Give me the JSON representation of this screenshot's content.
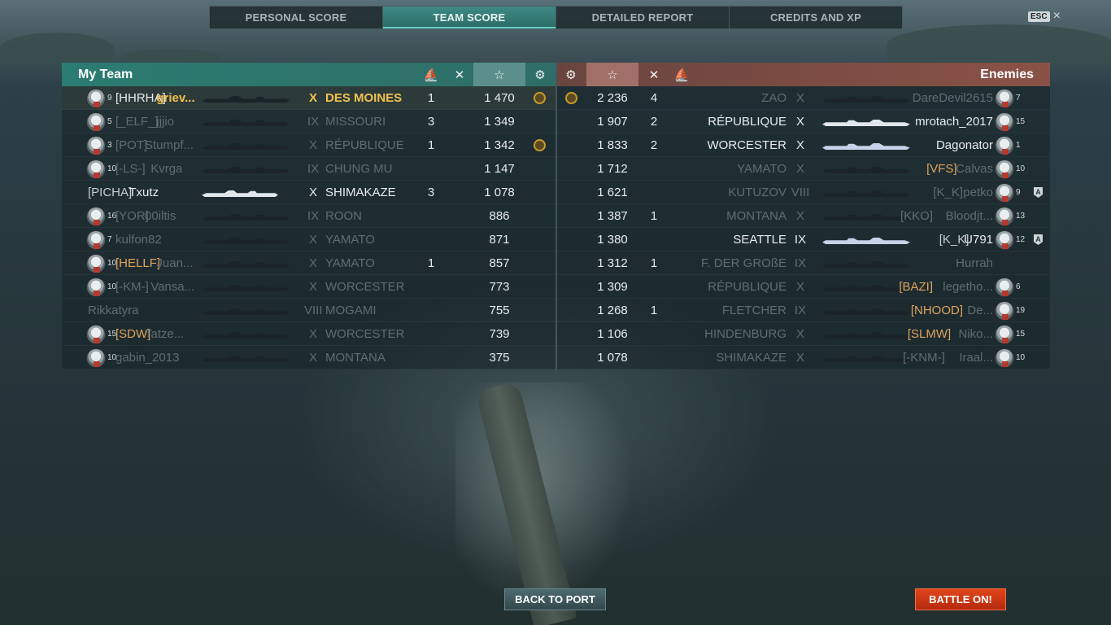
{
  "tabs": [
    {
      "label": "PERSONAL SCORE"
    },
    {
      "label": "TEAM SCORE"
    },
    {
      "label": "DETAILED REPORT"
    },
    {
      "label": "CREDITS AND XP"
    }
  ],
  "active_tab": "TEAM SCORE",
  "esc": {
    "key": "ESC",
    "close": "×"
  },
  "my_team": {
    "title": "My Team",
    "header_icons": [
      "ribbon-icon",
      "kills-icon",
      "star-icon",
      "achievement-icon"
    ],
    "players": [
      {
        "level": "9",
        "clan": "[HHRHA]",
        "name": "griev...",
        "tier": "X",
        "ship": "DES MOINES",
        "ribbon": "1",
        "score": "1 470",
        "medal": true,
        "me": true
      },
      {
        "level": "5",
        "clan": "[_ELF_]",
        "name": "jjjio",
        "tier": "IX",
        "ship": "MISSOURI",
        "ribbon": "3",
        "score": "1 349",
        "medal": false,
        "dead": true
      },
      {
        "level": "3",
        "clan": "[POT]",
        "name": "Stumpf...",
        "tier": "X",
        "ship": "RÉPUBLIQUE",
        "ribbon": "1",
        "score": "1 342",
        "medal": true,
        "dead": true
      },
      {
        "level": "10",
        "clan": "[-LS-]",
        "name": "Kvrga",
        "tier": "IX",
        "ship": "CHUNG MU",
        "ribbon": "",
        "score": "1 147",
        "medal": false,
        "dead": true
      },
      {
        "level": "",
        "clan": "[PICHA]",
        "name": "Txutz",
        "tier": "X",
        "ship": "SHIMAKAZE",
        "ribbon": "3",
        "score": "1 078",
        "medal": false,
        "alive": true
      },
      {
        "level": "16",
        "clan": "[YOR]",
        "name": "00iltis",
        "tier": "IX",
        "ship": "ROON",
        "ribbon": "",
        "score": "886",
        "medal": false,
        "dead": true
      },
      {
        "level": "7",
        "clan": "",
        "name": "kulfon82",
        "tier": "X",
        "ship": "YAMATO",
        "ribbon": "",
        "score": "871",
        "medal": false,
        "dead": true
      },
      {
        "level": "10",
        "clan": "[HELLF]",
        "name": "Juan...",
        "tier": "X",
        "ship": "YAMATO",
        "ribbon": "1",
        "score": "857",
        "medal": false,
        "dead": true,
        "clan_orange": true
      },
      {
        "level": "10",
        "clan": "[-KM-]",
        "name": "Vansa...",
        "tier": "X",
        "ship": "WORCESTER",
        "ribbon": "",
        "score": "773",
        "medal": false,
        "dead": true
      },
      {
        "level": "",
        "clan": "",
        "name": "Rikkatyra",
        "tier": "VIII",
        "ship": "MOGAMI",
        "ribbon": "",
        "score": "755",
        "medal": false,
        "dead": true
      },
      {
        "level": "15",
        "clan": "[SDW]",
        "name": "Tatze...",
        "tier": "X",
        "ship": "WORCESTER",
        "ribbon": "",
        "score": "739",
        "medal": false,
        "dead": true,
        "clan_orange": true
      },
      {
        "level": "10",
        "clan": "",
        "name": "gabin_2013",
        "tier": "X",
        "ship": "MONTANA",
        "ribbon": "",
        "score": "375",
        "medal": false,
        "dead": true
      }
    ]
  },
  "enemies": {
    "title": "Enemies",
    "header_icons": [
      "achievement-icon",
      "star-icon",
      "kills-icon",
      "ribbon-icon"
    ],
    "players": [
      {
        "score": "2 236",
        "ribbon": "4",
        "ship": "ZAO",
        "tier": "X",
        "clan": "",
        "name": "DareDevil2615",
        "level": "7",
        "medal": true,
        "dead": true
      },
      {
        "score": "1 907",
        "ribbon": "2",
        "ship": "RÉPUBLIQUE",
        "tier": "X",
        "clan": "",
        "name": "mrotach_2017",
        "level": "15",
        "medal": false,
        "alive": true
      },
      {
        "score": "1 833",
        "ribbon": "2",
        "ship": "WORCESTER",
        "tier": "X",
        "clan": "",
        "name": "Dagonator",
        "level": "1",
        "medal": false,
        "alive": true
      },
      {
        "score": "1 712",
        "ribbon": "",
        "ship": "YAMATO",
        "tier": "X",
        "clan": "[VFS]",
        "name": "Calvas",
        "level": "10",
        "medal": false,
        "dead": true,
        "clan_orange": true
      },
      {
        "score": "1 621",
        "ribbon": "",
        "ship": "KUTUZOV",
        "tier": "VIII",
        "clan": "[K_K]",
        "name": "petko",
        "level": "9",
        "medal": false,
        "dead": true,
        "flag": "A"
      },
      {
        "score": "1 387",
        "ribbon": "1",
        "ship": "MONTANA",
        "tier": "X",
        "clan": "[KKO]",
        "name": "Bloodjt...",
        "level": "13",
        "medal": false,
        "dead": true
      },
      {
        "score": "1 380",
        "ribbon": "",
        "ship": "SEATTLE",
        "tier": "IX",
        "clan": "[K_K]",
        "name": "U791",
        "level": "12",
        "medal": false,
        "alive": true,
        "flag": "A"
      },
      {
        "score": "1 312",
        "ribbon": "1",
        "ship": "F. DER GROßE",
        "tier": "IX",
        "clan": "",
        "name": "Hurrah",
        "level": "",
        "medal": false,
        "dead": true
      },
      {
        "score": "1 309",
        "ribbon": "",
        "ship": "RÉPUBLIQUE",
        "tier": "X",
        "clan": "[BAZI]",
        "name": "legetho...",
        "level": "6",
        "medal": false,
        "dead": true,
        "clan_orange": true
      },
      {
        "score": "1 268",
        "ribbon": "1",
        "ship": "FLETCHER",
        "tier": "IX",
        "clan": "[NHOOD]",
        "name": "De...",
        "level": "19",
        "medal": false,
        "dead": true,
        "clan_orange": true
      },
      {
        "score": "1 106",
        "ribbon": "",
        "ship": "HINDENBURG",
        "tier": "X",
        "clan": "[SLMW]",
        "name": "Niko...",
        "level": "15",
        "medal": false,
        "dead": true,
        "clan_orange": true
      },
      {
        "score": "1 078",
        "ribbon": "",
        "ship": "SHIMAKAZE",
        "tier": "X",
        "clan": "[-KNM-]",
        "name": "Iraal...",
        "level": "10",
        "medal": false,
        "dead": true
      }
    ]
  },
  "buttons": {
    "back": "BACK TO PORT",
    "battle": "BATTLE ON!"
  }
}
